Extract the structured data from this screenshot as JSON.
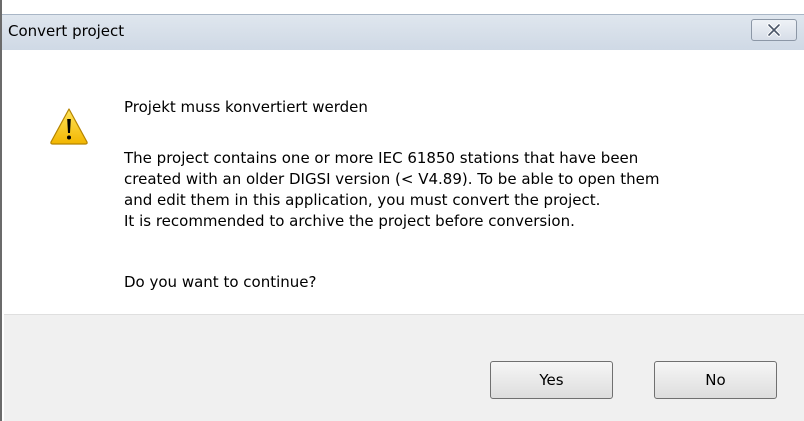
{
  "dialog": {
    "title": "Convert project",
    "heading": "Projekt muss konvertiert werden",
    "body_lines": [
      "The project contains one or more IEC 61850 stations that have been",
      "created with an older DIGSI version (< V4.89). To be able to open them",
      "and edit them in this application, you must convert the project.",
      "It is recommended to archive the project before conversion."
    ],
    "question": "Do you want to continue?",
    "icon": "warning-icon",
    "buttons": {
      "yes_label": "Yes",
      "no_label": "No"
    }
  },
  "colors": {
    "titlebar": "#d6dfea",
    "footer": "#f0f0f0",
    "warning_yellow": "#f5c400"
  }
}
